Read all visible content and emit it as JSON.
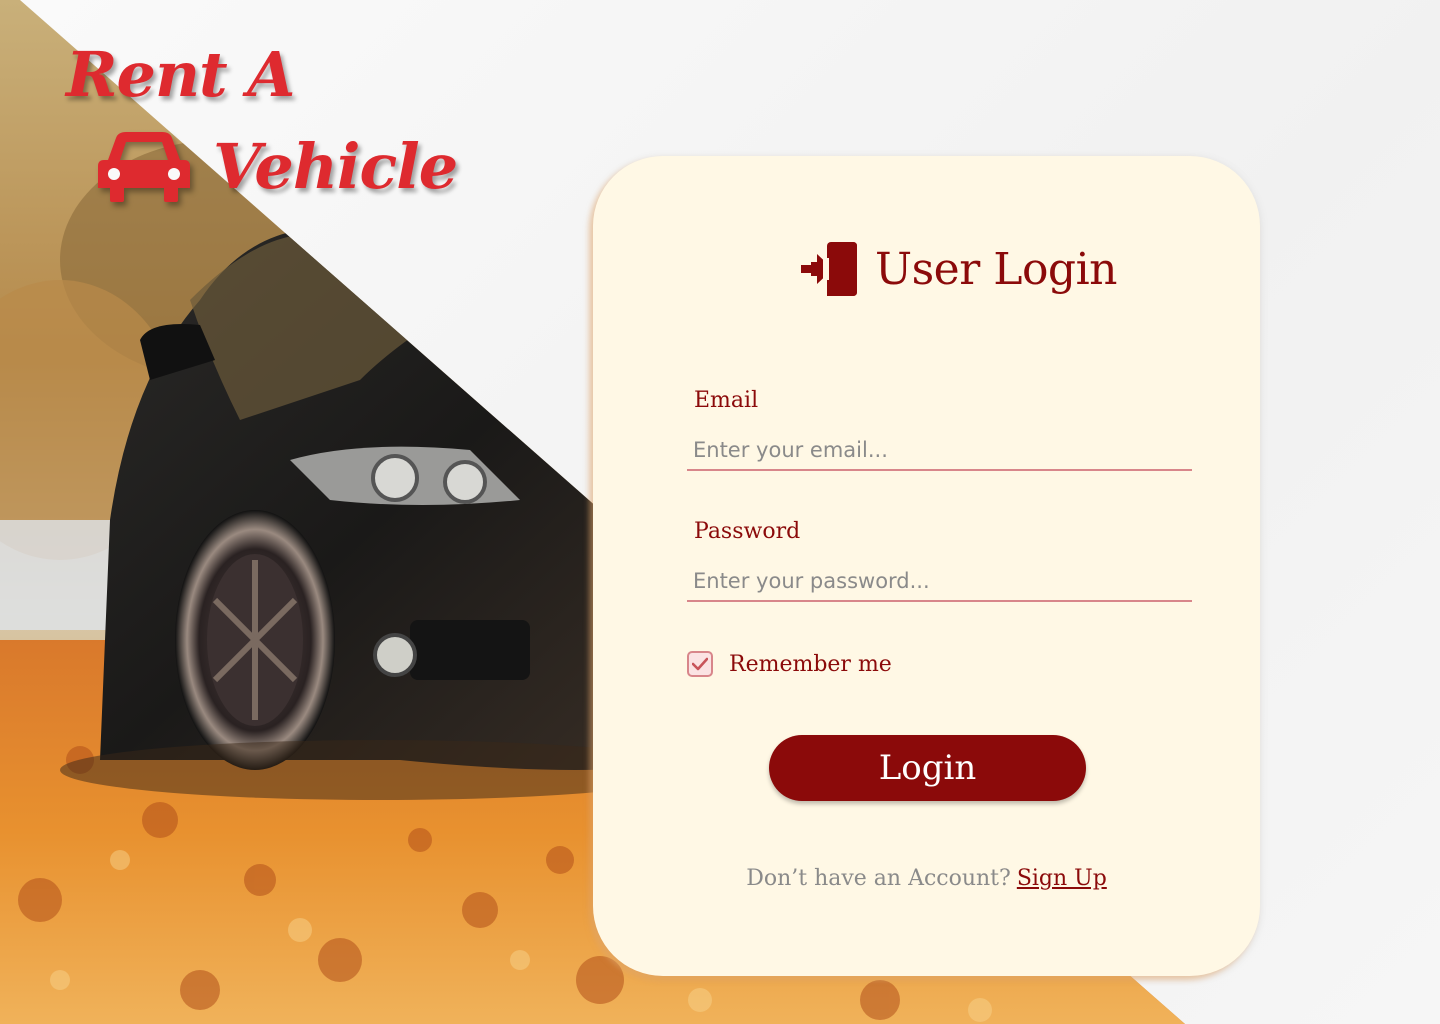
{
  "brand": {
    "line1": "Rent A",
    "line2": "Vehicle",
    "color": "#de2a2f"
  },
  "hero": {
    "image": "car-photo-autumn-leaves"
  },
  "login_card": {
    "title": "User Login",
    "title_icon": "login-door-icon",
    "email": {
      "label": "Email",
      "placeholder": "Enter your email..."
    },
    "password": {
      "label": "Password",
      "placeholder": "Enter your password..."
    },
    "remember": {
      "label": "Remember me",
      "checked": true
    },
    "login_button": "Login",
    "signup_prompt": "Don’t have an Account?",
    "signup_link": "Sign Up"
  },
  "colors": {
    "primary": "#8b0a0a",
    "card_bg": "#fff8e5",
    "accent": "#d8868a"
  }
}
